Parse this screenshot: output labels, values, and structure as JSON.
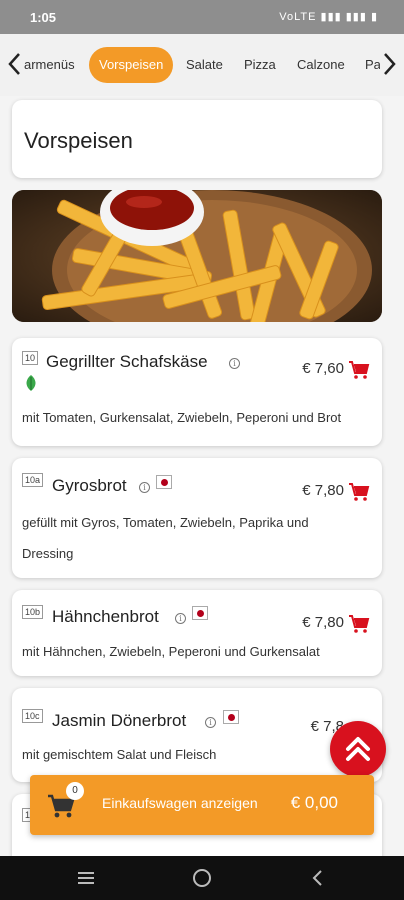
{
  "status_bar": {
    "time": "1:05",
    "indicators": "VoLTE ▮▮▮ ▮▮▮ ▮"
  },
  "categories": {
    "items": [
      "armenüs",
      "Vorspeisen",
      "Salate",
      "Pizza",
      "Calzone",
      "Pa"
    ],
    "active": "Vorspeisen"
  },
  "section": {
    "title": "Vorspeisen"
  },
  "menu_items": [
    {
      "number": "10",
      "name": "Gegrillter Schafskäse",
      "price": "€ 7,60",
      "description": "mit Tomaten, Gurkensalat, Zwiebeln, Peperoni und Brot",
      "badge": "leaf-icon"
    },
    {
      "number": "10a",
      "name": "Gyrosbrot",
      "price": "€ 7,80",
      "description_line1": "gefüllt mit Gyros, Tomaten, Zwiebeln, Paprika und",
      "description_line2": "Dressing",
      "badge": "flag-icon"
    },
    {
      "number": "10b",
      "name": "Hähnchenbrot",
      "price": "€ 7,80",
      "description": "mit Hähnchen, Zwiebeln, Peperoni und Gurkensalat",
      "badge": "flag-icon"
    },
    {
      "number": "10c",
      "name": "Jasmin Dönerbrot",
      "price": "€ 7,8",
      "description": "mit gemischtem Salat und Fleisch",
      "badge": "flag-icon"
    }
  ],
  "partial_item": {
    "number": "1",
    "description_fragment": "... ... ... ..."
  },
  "cart": {
    "count": "0",
    "label": "Einkaufswagen anzeigen",
    "total": "€ 0,00"
  },
  "colors": {
    "accent": "#f39a27",
    "cart_red": "#d8111e",
    "status_gray": "#8e8e8e"
  }
}
